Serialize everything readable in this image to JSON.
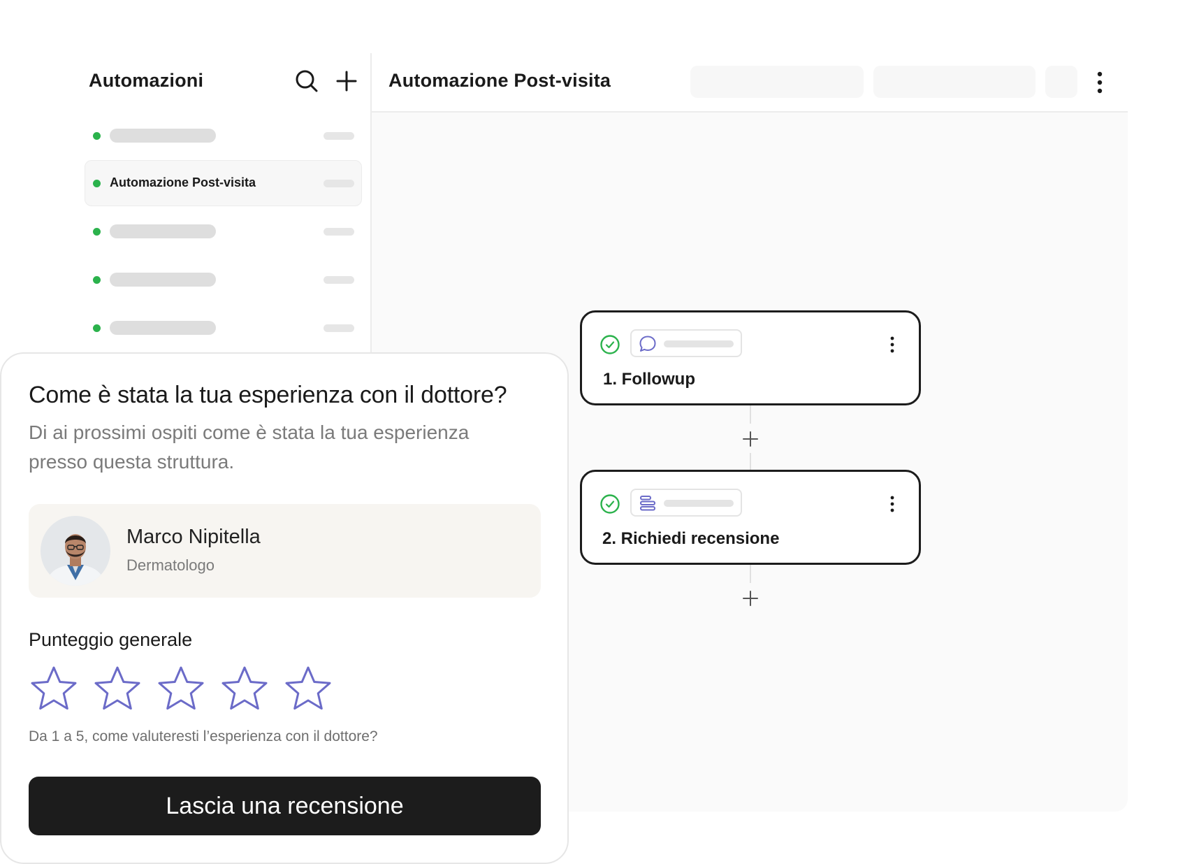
{
  "sidebar": {
    "title": "Automazioni",
    "icons": {
      "search": "search-icon",
      "add": "plus-icon"
    },
    "items": [
      {
        "label": "",
        "status": "active"
      },
      {
        "label": "Automazione Post-visita",
        "status": "active",
        "selected": true
      },
      {
        "label": "",
        "status": "active"
      },
      {
        "label": "",
        "status": "active"
      },
      {
        "label": "",
        "status": "active"
      }
    ]
  },
  "main": {
    "title": "Automazione Post-visita",
    "more_icon": "kebab-menu-icon",
    "steps": [
      {
        "title": "1. Followup",
        "status_icon": "check-circle-icon",
        "type_icon": "chat-bubble-icon"
      },
      {
        "title": "2. Richiedi recensione",
        "status_icon": "check-circle-icon",
        "type_icon": "form-lines-icon"
      }
    ],
    "add_icon": "plus-icon"
  },
  "review": {
    "question": "Come è stata la tua esperienza con il dottore?",
    "subtitle": "Di ai prossimi ospiti come è stata la tua esperienza presso questa struttura.",
    "doctor": {
      "name": "Marco Nipitella",
      "role": "Dermatologo"
    },
    "score_label": "Punteggio generale",
    "rating": {
      "value": 0,
      "max": 5
    },
    "hint": "Da 1 a 5, come valuteresti l’esperienza con il dottore?",
    "cta": "Lascia una recensione"
  },
  "colors": {
    "status_green": "#2bb24c",
    "star_outline": "#6b6bc8",
    "icon_purple": "#6b6bc8",
    "button_dark": "#1c1c1c",
    "doctor_box": "#f7f5f1"
  }
}
